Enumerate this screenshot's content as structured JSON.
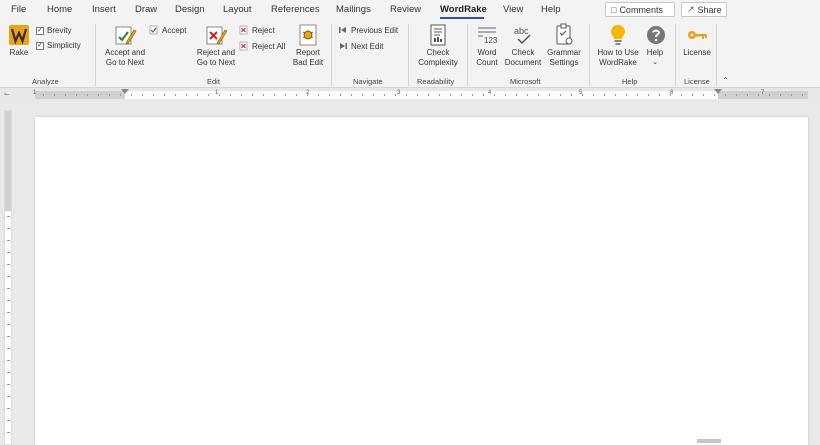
{
  "menu": {
    "tabs": [
      "File",
      "Home",
      "Insert",
      "Draw",
      "Design",
      "Layout",
      "References",
      "Mailings",
      "Review",
      "WordRake",
      "View",
      "Help"
    ],
    "active_tab": "WordRake",
    "comments_label": "Comments",
    "share_label": "Share"
  },
  "ribbon": {
    "analyze": {
      "rake_label": "Rake",
      "brevity_label": "Brevity",
      "simplicity_label": "Simplicity",
      "group_label": "Analyze"
    },
    "edit": {
      "accept_next_line1": "Accept and",
      "accept_next_line2": "Go to Next",
      "accept_label": "Accept",
      "reject_next_line1": "Reject and",
      "reject_next_line2": "Go to Next",
      "reject_label": "Reject",
      "reject_all_label": "Reject All",
      "report_line1": "Report",
      "report_line2": "Bad Edit",
      "group_label": "Edit"
    },
    "navigate": {
      "previous_edit_label": "Previous Edit",
      "next_edit_label": "Next Edit",
      "group_label": "Navigate"
    },
    "readability": {
      "check_line1": "Check",
      "check_line2": "Complexity",
      "group_label": "Readability"
    },
    "microsoft": {
      "word_count_line1": "Word",
      "word_count_line2": "Count",
      "check_doc_line1": "Check",
      "check_doc_line2": "Document",
      "grammar_line1": "Grammar",
      "grammar_line2": "Settings",
      "word_count_icon_text": "123",
      "abc_icon_text": "abc",
      "group_label": "Microsoft"
    },
    "help": {
      "how_to_line1": "How to Use",
      "how_to_line2": "WordRake",
      "help_label": "Help",
      "group_label": "Help"
    },
    "license": {
      "license_label": "License",
      "group_label": "License"
    }
  },
  "ruler": {
    "numbers": [
      "1",
      "1",
      "2",
      "3",
      "4",
      "5",
      "6",
      "7"
    ]
  },
  "colors": {
    "accent": "#2b579a",
    "wordrake_gold": "#e8a317",
    "ribbon_bg": "#f3f3f3"
  }
}
